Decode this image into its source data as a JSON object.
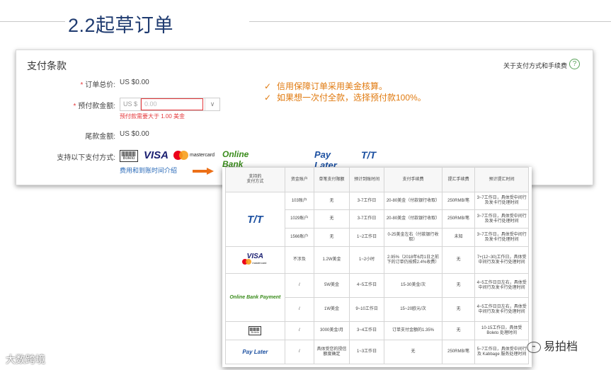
{
  "slide": {
    "title": "2.2起草订单"
  },
  "card": {
    "title": "支付条款",
    "link": "关于支付方式和手续费",
    "help": "?",
    "total_label": "订单总价:",
    "total_value": "US $0.00",
    "prepay_label": "预付款金额:",
    "prepay_currency": "US $",
    "prepay_placeholder": "0.00",
    "prepay_error": "预付款需要大于 1.00 美金",
    "balance_label": "尾款金额:",
    "balance_value": "US $0.00",
    "methods_label": "支持以下支付方式:",
    "fee_link": "费用和到账时间介绍",
    "notes": [
      "信用保障订单采用美金核算。",
      "如果想一次付全款，选择预付款100%。"
    ],
    "note_check": "✓"
  },
  "logos": {
    "boleto": "Boleto",
    "visa": "VISA",
    "mastercard": "mastercard",
    "online_bank": "Online Bank Payment",
    "pay_later": "Pay Later",
    "tt": "T/T"
  },
  "fee_table": {
    "headers": [
      "支持的\n支付方式",
      "资金账户",
      "单笔支付限额",
      "预计到账时间",
      "支付手续费",
      "提汇手续费",
      "预计提汇时间"
    ],
    "rows": [
      [
        "103账户",
        "无",
        "3-7工作日",
        "20-80美金（付款银行收取）",
        "250RMB/笔",
        "3~7工作日，具体受中间行及发卡行处理时间"
      ],
      [
        "1029账户",
        "无",
        "3-7工作日",
        "20-80美金（付款银行收取）",
        "250RMB/笔",
        "3~7工作日，具体受中间行及发卡行处理时间"
      ],
      [
        "1566账户",
        "无",
        "1~2工作日",
        "0-25美金左右（付款银行收取）",
        "未知",
        "3~7工作日，具体受中间行及发卡行处理时间"
      ],
      [
        "不涉及",
        "1.2W美金",
        "1~2小时",
        "2.95%（2018年6月1日之前下的订单仍按照2.4%收费）",
        "无",
        "7+(12~30)工作日，具体受中间行及发卡行处理时间"
      ],
      [
        "/",
        "5W美金",
        "4~5工作日",
        "15-30美金/次",
        "无",
        "4~5工作日日左右，具体受中间行及发卡行处理时间"
      ],
      [
        "/",
        "1W美金",
        "9~10工作日",
        "15~20欧元/次",
        "无",
        "4~5工作日日左右，具体受中间行及发卡行处理时间"
      ],
      [
        "/",
        "3000美金/月",
        "3~4工作日",
        "订单支付金额的1.35%",
        "无",
        "10-15工作日，具体受Boleto 处理时间"
      ],
      [
        "/",
        "具体受您的授信额度确定",
        "1~3工作日",
        "无",
        "250RMB/笔",
        "5~7工作日，具体受中间行及 Kabbage 服务处理时间"
      ]
    ]
  },
  "watermark": {
    "left": "大数跨境",
    "right": "易拍档"
  }
}
